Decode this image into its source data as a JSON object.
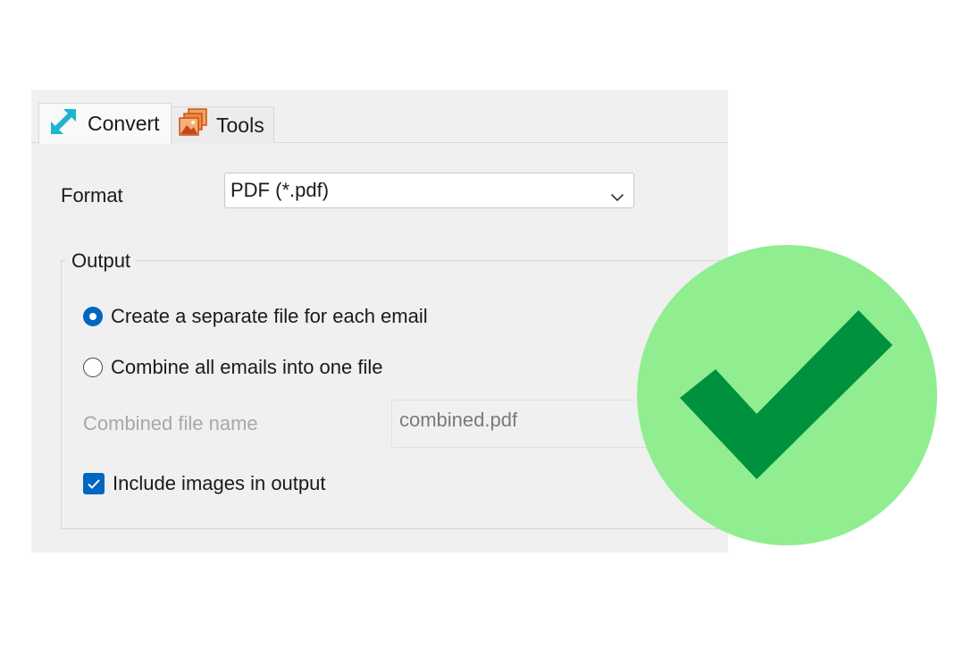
{
  "tabs": [
    {
      "label": "Convert",
      "icon": "convert-arrow-icon",
      "selected": true
    },
    {
      "label": "Tools",
      "icon": "tools-images-icon",
      "selected": false
    }
  ],
  "format": {
    "label": "Format",
    "selected_value": "PDF (*.pdf)"
  },
  "output": {
    "title": "Output",
    "options": [
      {
        "label": "Create a separate file for each email",
        "checked": true
      },
      {
        "label": "Combine all emails into one file",
        "checked": false
      }
    ],
    "combined_name": {
      "label": "Combined file name",
      "value": "combined.pdf",
      "enabled": false
    },
    "include_images": {
      "label": "Include images in output",
      "checked": true
    }
  },
  "badge": {
    "icon": "checkmark-icon",
    "color": "#90ee90",
    "mark_color": "#00913f"
  },
  "colors": {
    "accent": "#0067c0",
    "panel": "#f0f0f0"
  }
}
